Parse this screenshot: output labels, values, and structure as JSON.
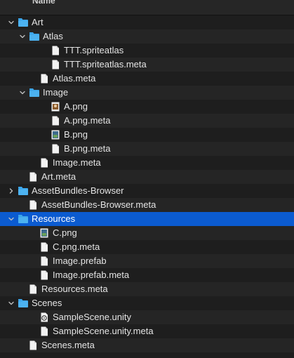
{
  "header": {
    "name_label": "Name"
  },
  "colors": {
    "background": "#1e1e1e",
    "row_alt": "#252525",
    "selection": "#0b5bd0",
    "folder": "#3ca7ec",
    "text": "#e4e4e4"
  },
  "rows": [
    {
      "label": "Art",
      "type": "folder",
      "expanded": true,
      "depth": 0
    },
    {
      "label": "Atlas",
      "type": "folder",
      "expanded": true,
      "depth": 1
    },
    {
      "label": "TTT.spriteatlas",
      "type": "file",
      "depth": 2
    },
    {
      "label": "TTT.spriteatlas.meta",
      "type": "file",
      "depth": 2
    },
    {
      "label": "Atlas.meta",
      "type": "file",
      "depth": 1
    },
    {
      "label": "Image",
      "type": "folder",
      "expanded": true,
      "depth": 1
    },
    {
      "label": "A.png",
      "type": "image",
      "depth": 2
    },
    {
      "label": "A.png.meta",
      "type": "file",
      "depth": 2
    },
    {
      "label": "B.png",
      "type": "image",
      "depth": 2
    },
    {
      "label": "B.png.meta",
      "type": "file",
      "depth": 2
    },
    {
      "label": "Image.meta",
      "type": "file",
      "depth": 1
    },
    {
      "label": "Art.meta",
      "type": "file",
      "depth": 0
    },
    {
      "label": "AssetBundles-Browser",
      "type": "folder",
      "expanded": false,
      "depth": 0
    },
    {
      "label": "AssetBundles-Browser.meta",
      "type": "file",
      "depth": 0
    },
    {
      "label": "Resources",
      "type": "folder",
      "expanded": true,
      "depth": 0,
      "selected": true
    },
    {
      "label": "C.png",
      "type": "image",
      "depth": 1
    },
    {
      "label": "C.png.meta",
      "type": "file",
      "depth": 1
    },
    {
      "label": "Image.prefab",
      "type": "file",
      "depth": 1
    },
    {
      "label": "Image.prefab.meta",
      "type": "file",
      "depth": 1
    },
    {
      "label": "Resources.meta",
      "type": "file",
      "depth": 0
    },
    {
      "label": "Scenes",
      "type": "folder",
      "expanded": true,
      "depth": 0
    },
    {
      "label": "SampleScene.unity",
      "type": "unity",
      "depth": 1
    },
    {
      "label": "SampleScene.unity.meta",
      "type": "file",
      "depth": 1
    },
    {
      "label": "Scenes.meta",
      "type": "file",
      "depth": 0
    }
  ]
}
